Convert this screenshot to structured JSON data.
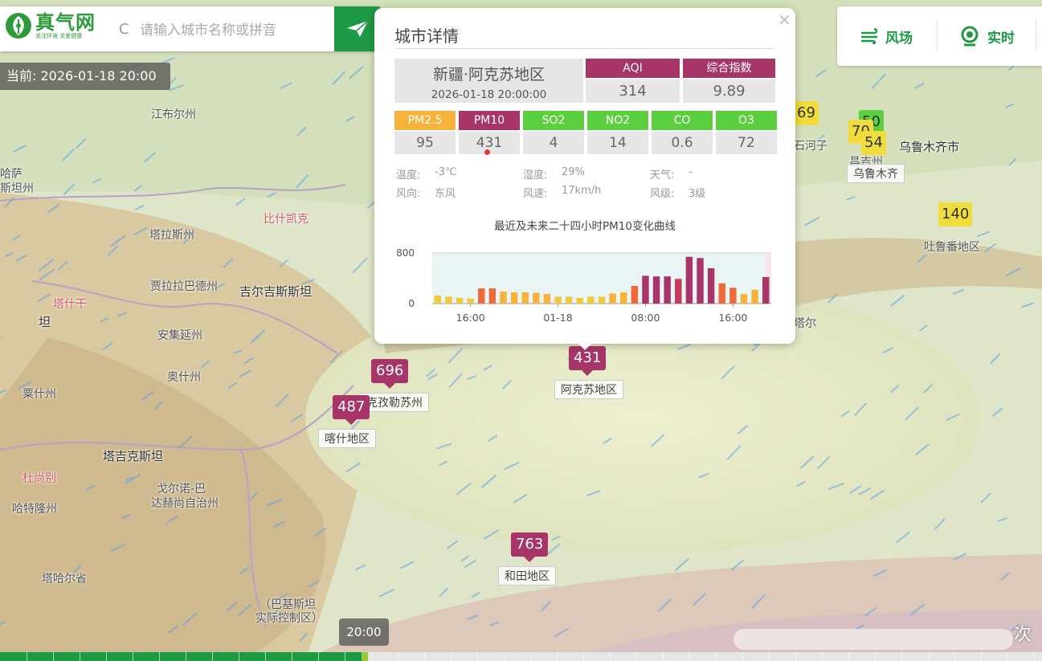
{
  "app": {
    "logo_title": "真气网",
    "logo_slogan": "关注环境 关爱健康",
    "search_icon_glyph": "C",
    "search_placeholder": "请输入城市名称或拼音",
    "current_time": "当前: 2026-01-18 20:00",
    "wind_label": "风场",
    "realtime_label": "实时",
    "timeline_tooltip": "20:00",
    "timeline_progress": 0.35,
    "accent_color": "#1e9a44"
  },
  "popup": {
    "title": "城市详情",
    "close": "×",
    "city": "新疆·阿克苏地区",
    "datetime": "2026-01-18 20:00:00",
    "aqi_label": "AQI",
    "aqi_value": "314",
    "index_label": "综合指数",
    "index_value": "9.89",
    "pollutants": [
      {
        "name": "PM2.5",
        "value": "95",
        "color": "#f7b23b"
      },
      {
        "name": "PM10",
        "value": "431",
        "color": "#a8356a"
      },
      {
        "name": "SO2",
        "value": "4",
        "color": "#5ccf3f"
      },
      {
        "name": "NO2",
        "value": "14",
        "color": "#5ccf3f"
      },
      {
        "name": "CO",
        "value": "0.6",
        "color": "#5ccf3f"
      },
      {
        "name": "O3",
        "value": "72",
        "color": "#5ccf3f"
      }
    ],
    "weather": [
      {
        "label": "温度:",
        "value": "-3℃"
      },
      {
        "label": "湿度:",
        "value": "29%"
      },
      {
        "label": "天气:",
        "value": "-"
      },
      {
        "label": "风向:",
        "value": "东风"
      },
      {
        "label": "风速:",
        "value": "17km/h"
      },
      {
        "label": "风级:",
        "value": "3级"
      }
    ],
    "chart_title": "最近及未来二十四小时PM10变化曲线"
  },
  "chart_data": {
    "type": "bar",
    "title": "最近及未来二十四小时PM10变化曲线",
    "ylim": [
      0,
      800
    ],
    "yticks": [
      "800",
      "0"
    ],
    "xticks": [
      "16:00",
      "01-18",
      "08:00",
      "16:00"
    ],
    "xtick_index": [
      3,
      11,
      19,
      27
    ],
    "values": [
      130,
      110,
      90,
      80,
      240,
      240,
      190,
      180,
      180,
      170,
      150,
      110,
      110,
      90,
      110,
      110,
      160,
      180,
      280,
      440,
      430,
      430,
      390,
      740,
      720,
      560,
      320,
      250,
      150,
      220,
      420
    ],
    "colors": [
      "#f0c83c",
      "#f0c83c",
      "#f0c83c",
      "#f0c83c",
      "#ef6a3a",
      "#ef6a3a",
      "#f7b23b",
      "#f7b23b",
      "#f7b23b",
      "#f7b23b",
      "#f7b23b",
      "#f0c83c",
      "#f0c83c",
      "#f0c83c",
      "#f0c83c",
      "#f0c83c",
      "#f7b23b",
      "#f7b23b",
      "#ef6a3a",
      "#a8356a",
      "#a8356a",
      "#a8356a",
      "#c23a5a",
      "#a8356a",
      "#a8356a",
      "#a8356a",
      "#ef6a3a",
      "#ef6a3a",
      "#f7b23b",
      "#f7b23b",
      "#a8356a"
    ],
    "grid": false
  },
  "map": {
    "places": [
      {
        "text": "江布尔州",
        "cls": ""
      },
      {
        "text": "哈萨",
        "cls": ""
      },
      {
        "text": "斯坦州",
        "cls": ""
      },
      {
        "text": "比什凯克",
        "cls": "place-red"
      },
      {
        "text": "塔拉斯州",
        "cls": ""
      },
      {
        "text": "贾拉拉巴德州",
        "cls": ""
      },
      {
        "text": "吉尔吉斯斯坦",
        "cls": "place-dark"
      },
      {
        "text": "塔什干",
        "cls": "place-red"
      },
      {
        "text": "坦",
        "cls": "place-dark"
      },
      {
        "text": "安集延州",
        "cls": ""
      },
      {
        "text": "奥什州",
        "cls": ""
      },
      {
        "text": "粟什州",
        "cls": ""
      },
      {
        "text": "塔吉克斯坦",
        "cls": "place-dark"
      },
      {
        "text": "杜尚别",
        "cls": "place-red"
      },
      {
        "text": "哈特隆州",
        "cls": ""
      },
      {
        "text": "戈尔诺-巴",
        "cls": ""
      },
      {
        "text": "达赫尚自治州",
        "cls": ""
      },
      {
        "text": "塔哈尔省",
        "cls": ""
      },
      {
        "text": "（巴基斯坦",
        "cls": ""
      },
      {
        "text": "实际控制区）",
        "cls": ""
      },
      {
        "text": "石河子",
        "cls": ""
      },
      {
        "text": "乌鲁木齐市",
        "cls": "place-dark"
      },
      {
        "text": "昌吉州",
        "cls": ""
      },
      {
        "text": "吐鲁番地区",
        "cls": ""
      },
      {
        "text": "塔尔",
        "cls": ""
      }
    ],
    "markers": [
      {
        "value": "431",
        "city": "阿克苏地区",
        "color": "#a8356a"
      },
      {
        "value": "696",
        "city": "克孜勒苏州",
        "color": "#a8356a"
      },
      {
        "value": "487",
        "city": "喀什地区",
        "color": "#a8356a"
      },
      {
        "value": "763",
        "city": "和田地区",
        "color": "#a8356a"
      }
    ],
    "badges": [
      {
        "value": "69"
      },
      {
        "value": "50"
      },
      {
        "value": "70"
      },
      {
        "value": "54"
      },
      {
        "value": "140"
      }
    ],
    "badge_cities": [
      "乌鲁木齐"
    ],
    "corner_glyph": "次"
  }
}
